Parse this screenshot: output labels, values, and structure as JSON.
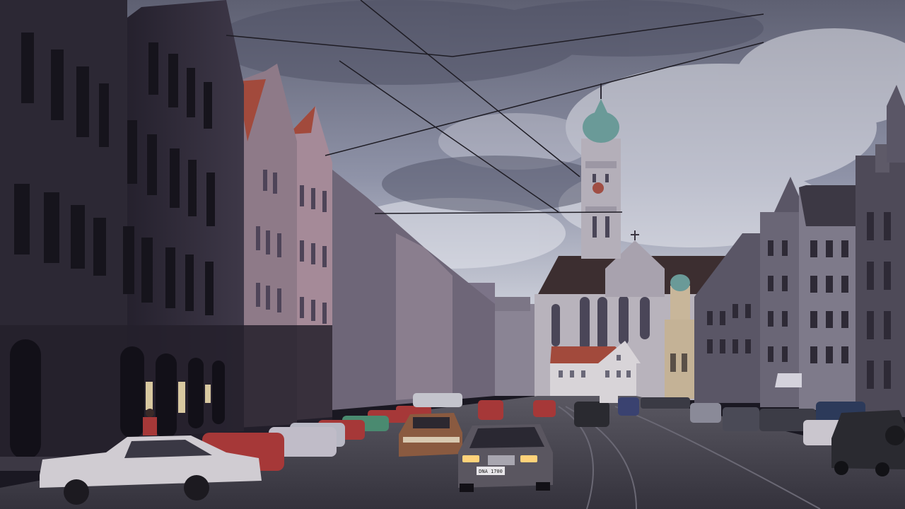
{
  "scene": {
    "subject": "street-view-with-cathedral-tower",
    "colors": {
      "sky_top": "#5e6072",
      "sky_mid": "#8f93a8",
      "sky_light": "#cfd2dc",
      "cloud": "#e4e5ec",
      "building_dark": "#2c2834",
      "building_mid": "#4a4458",
      "building_pink": "#9c8490",
      "building_far": "#8a8494",
      "roof_red": "#a24a3c",
      "church_wall": "#b8b3bc",
      "church_roof": "#3c2e30",
      "dome_green": "#6a9a98",
      "white_house": "#d8d4d8",
      "road": "#4a4852",
      "road_near": "#3c3a44",
      "car_white": "#d0ccd2",
      "car_red": "#a63838",
      "car_dark": "#2a2a30",
      "headlight": "#ffd27a"
    },
    "plate_text": "DNA 1700"
  }
}
